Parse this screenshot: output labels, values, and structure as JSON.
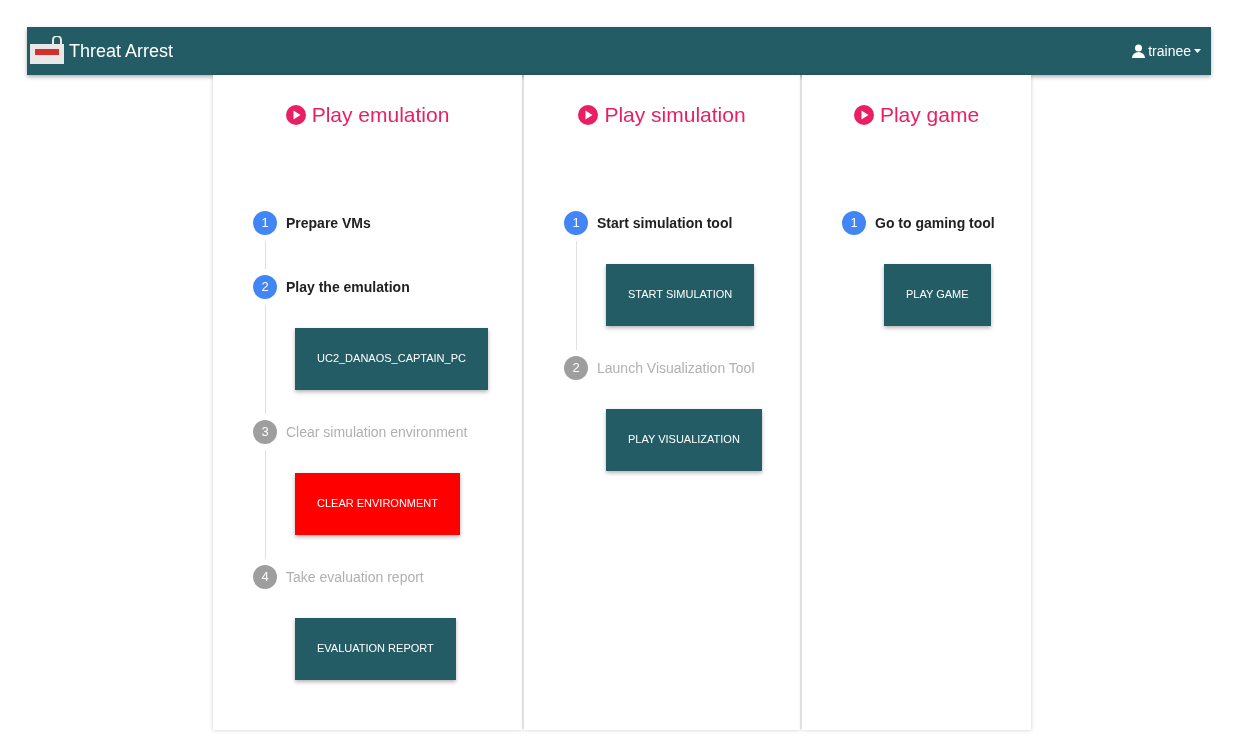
{
  "navbar": {
    "title": "Threat Arrest",
    "user": "trainee"
  },
  "columns": [
    {
      "title": "Play emulation",
      "steps": [
        {
          "number": "1",
          "label": "Prepare VMs",
          "active": true
        },
        {
          "number": "2",
          "label": "Play the emulation",
          "active": true,
          "button": {
            "label": "UC2_DANAOS_CAPTAIN_PC",
            "kind": "primary"
          }
        },
        {
          "number": "3",
          "label": "Clear simulation environment",
          "active": false,
          "button": {
            "label": "CLEAR ENVIRONMENT",
            "kind": "danger"
          }
        },
        {
          "number": "4",
          "label": "Take evaluation report",
          "active": false,
          "button": {
            "label": "EVALUATION REPORT",
            "kind": "primary"
          }
        }
      ]
    },
    {
      "title": "Play simulation",
      "steps": [
        {
          "number": "1",
          "label": "Start simulation tool",
          "active": true,
          "button": {
            "label": "START SIMULATION",
            "kind": "primary"
          }
        },
        {
          "number": "2",
          "label": "Launch Visualization Tool",
          "active": false,
          "button": {
            "label": "PLAY VISUALIZATION",
            "kind": "primary"
          }
        }
      ]
    },
    {
      "title": "Play game",
      "steps": [
        {
          "number": "1",
          "label": "Go to gaming tool",
          "active": true,
          "button": {
            "label": "PLAY GAME",
            "kind": "primary"
          }
        }
      ]
    }
  ]
}
